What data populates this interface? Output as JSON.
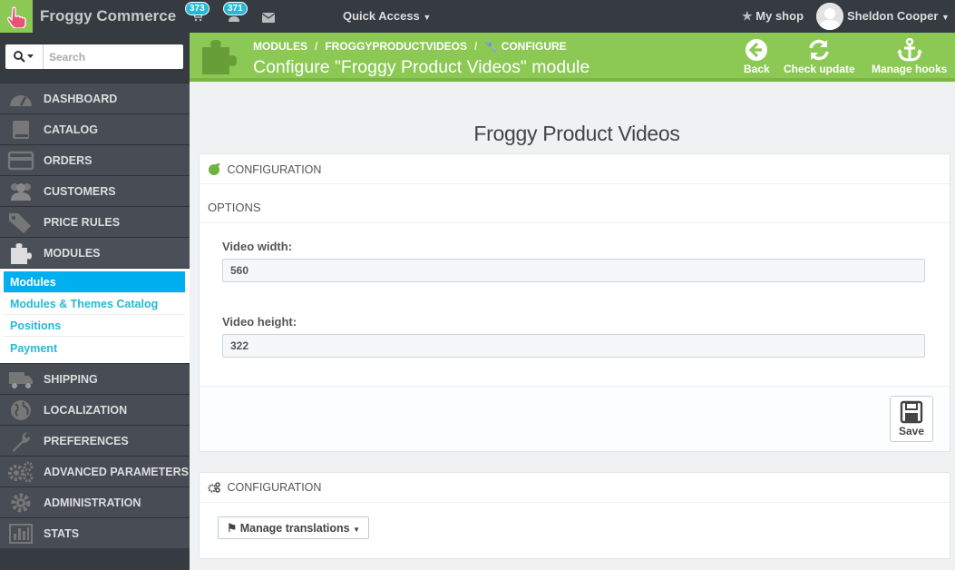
{
  "topbar": {
    "brand": "Froggy Commerce",
    "cart_count": "373",
    "customers_count": "371",
    "quick_access": "Quick Access",
    "my_shop": "My shop",
    "user_name": "Sheldon Cooper"
  },
  "sidebar": {
    "search_placeholder": "Search",
    "items": [
      {
        "label": "DASHBOARD",
        "icon": "dashboard-icon"
      },
      {
        "label": "CATALOG",
        "icon": "book-icon"
      },
      {
        "label": "ORDERS",
        "icon": "credit-card-icon"
      },
      {
        "label": "CUSTOMERS",
        "icon": "users-icon"
      },
      {
        "label": "PRICE RULES",
        "icon": "tags-icon"
      },
      {
        "label": "MODULES",
        "icon": "puzzle-icon"
      },
      {
        "label": "SHIPPING",
        "icon": "truck-icon"
      },
      {
        "label": "LOCALIZATION",
        "icon": "globe-icon"
      },
      {
        "label": "PREFERENCES",
        "icon": "wrench-icon"
      },
      {
        "label": "ADVANCED PARAMETERS",
        "icon": "cogs-icon"
      },
      {
        "label": "ADMINISTRATION",
        "icon": "cog-icon"
      },
      {
        "label": "STATS",
        "icon": "bar-chart-icon"
      }
    ],
    "submenu": [
      {
        "label": "Modules"
      },
      {
        "label": "Modules & Themes Catalog"
      },
      {
        "label": "Positions"
      },
      {
        "label": "Payment"
      }
    ]
  },
  "header": {
    "crumb_1": "MODULES",
    "crumb_2": "FROGGYPRODUCTVIDEOS",
    "crumb_3": "CONFIGURE",
    "title": "Configure \"Froggy Product Videos\" module",
    "back": "Back",
    "check_update": "Check update",
    "manage_hooks": "Manage hooks"
  },
  "main": {
    "heading": "Froggy Product Videos",
    "panel1": {
      "heading": "CONFIGURATION",
      "subheading": "OPTIONS",
      "width_label": "Video width:",
      "width_value": "560",
      "height_label": "Video height:",
      "height_value": "322",
      "save": "Save"
    },
    "panel2": {
      "heading": "CONFIGURATION",
      "manage_translations": "Manage translations"
    }
  },
  "colors": {
    "header_green": "#8bc954",
    "sidebar_dark": "#363a41",
    "accent_blue": "#25b9d7"
  }
}
